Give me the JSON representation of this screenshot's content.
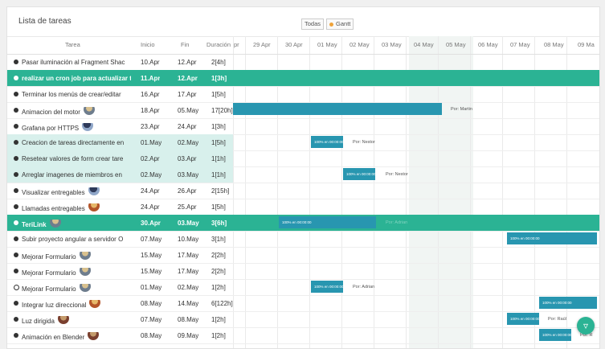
{
  "app": {
    "title": "Lista de tareas",
    "filter_all": "Todas",
    "filter_gantt": "Gantt",
    "fab_icon": "filter-icon"
  },
  "columns": {
    "task": "Tarea",
    "start": "Inicio",
    "end": "Fin",
    "duration": "Duración"
  },
  "timeline": {
    "partial_left": "pr",
    "dates": [
      "29 Apr",
      "30 Apr",
      "01 May",
      "02 May",
      "03 May",
      "04 May",
      "05 May",
      "06 May",
      "07 May",
      "08 May",
      "09 Ma"
    ]
  },
  "tasks": [
    {
      "name": "Pasar iluminación al Fragment Shac",
      "start": "10.Apr",
      "end": "12.Apr",
      "duration": "2[4h]"
    },
    {
      "name": "realizar un cron job para actualizar t",
      "start": "11.Apr",
      "end": "12.Apr",
      "duration": "1[3h]"
    },
    {
      "name": "Terminar los menús de crear/editar",
      "start": "16.Apr",
      "end": "17.Apr",
      "duration": "1[5h]"
    },
    {
      "name": "Animacion del motor",
      "start": "18.Apr",
      "end": "05.May",
      "duration": "17[20h]"
    },
    {
      "name": "Grafana por HTTPS",
      "start": "23.Apr",
      "end": "24.Apr",
      "duration": "1[3h]"
    },
    {
      "name": "Creacion de tareas directamente en",
      "start": "01.May",
      "end": "02.May",
      "duration": "1[5h]"
    },
    {
      "name": "Resetear valores de form crear tare",
      "start": "02.Apr",
      "end": "03.Apr",
      "duration": "1[1h]"
    },
    {
      "name": "Arreglar imagenes de miembros en",
      "start": "02.May",
      "end": "03.May",
      "duration": "1[1h]"
    },
    {
      "name": "Visualizar entregables",
      "start": "24.Apr",
      "end": "26.Apr",
      "duration": "2[15h]"
    },
    {
      "name": "Llamadas entregables",
      "start": "24.Apr",
      "end": "25.Apr",
      "duration": "1[5h]"
    },
    {
      "name": "TeriLink",
      "start": "30.Apr",
      "end": "03.May",
      "duration": "3[6h]"
    },
    {
      "name": "Subir proyecto angular a servidor O",
      "start": "07.May",
      "end": "10.May",
      "duration": "3[1h]"
    },
    {
      "name": "Mejorar Formulario",
      "start": "15.May",
      "end": "17.May",
      "duration": "2[2h]"
    },
    {
      "name": "Mejorar Formulario",
      "start": "15.May",
      "end": "17.May",
      "duration": "2[2h]"
    },
    {
      "name": "Mejorar Formulario",
      "start": "01.May",
      "end": "02.May",
      "duration": "1[2h]"
    },
    {
      "name": "Integrar luz direccional",
      "start": "08.May",
      "end": "14.May",
      "duration": "6[122h]"
    },
    {
      "name": "Luz dirigida",
      "start": "07.May",
      "end": "08.May",
      "duration": "1[2h]"
    },
    {
      "name": "Animación en Blender",
      "start": "08.May",
      "end": "09.May",
      "duration": "1[2h]"
    }
  ],
  "bars": {
    "progress": "100% en 00:00:00",
    "by_martin": "Por: Martin",
    "by_nestor": "Por: Nestor",
    "by_adrian": "Por: Adrian",
    "by_raul": "Por: Raúl",
    "by_cut": "Por: R",
    "by_teri": "Por: Adrian"
  },
  "colors": {
    "accent": "#2bb394",
    "bar": "#2896b0",
    "light_row": "#d8f0ec"
  }
}
